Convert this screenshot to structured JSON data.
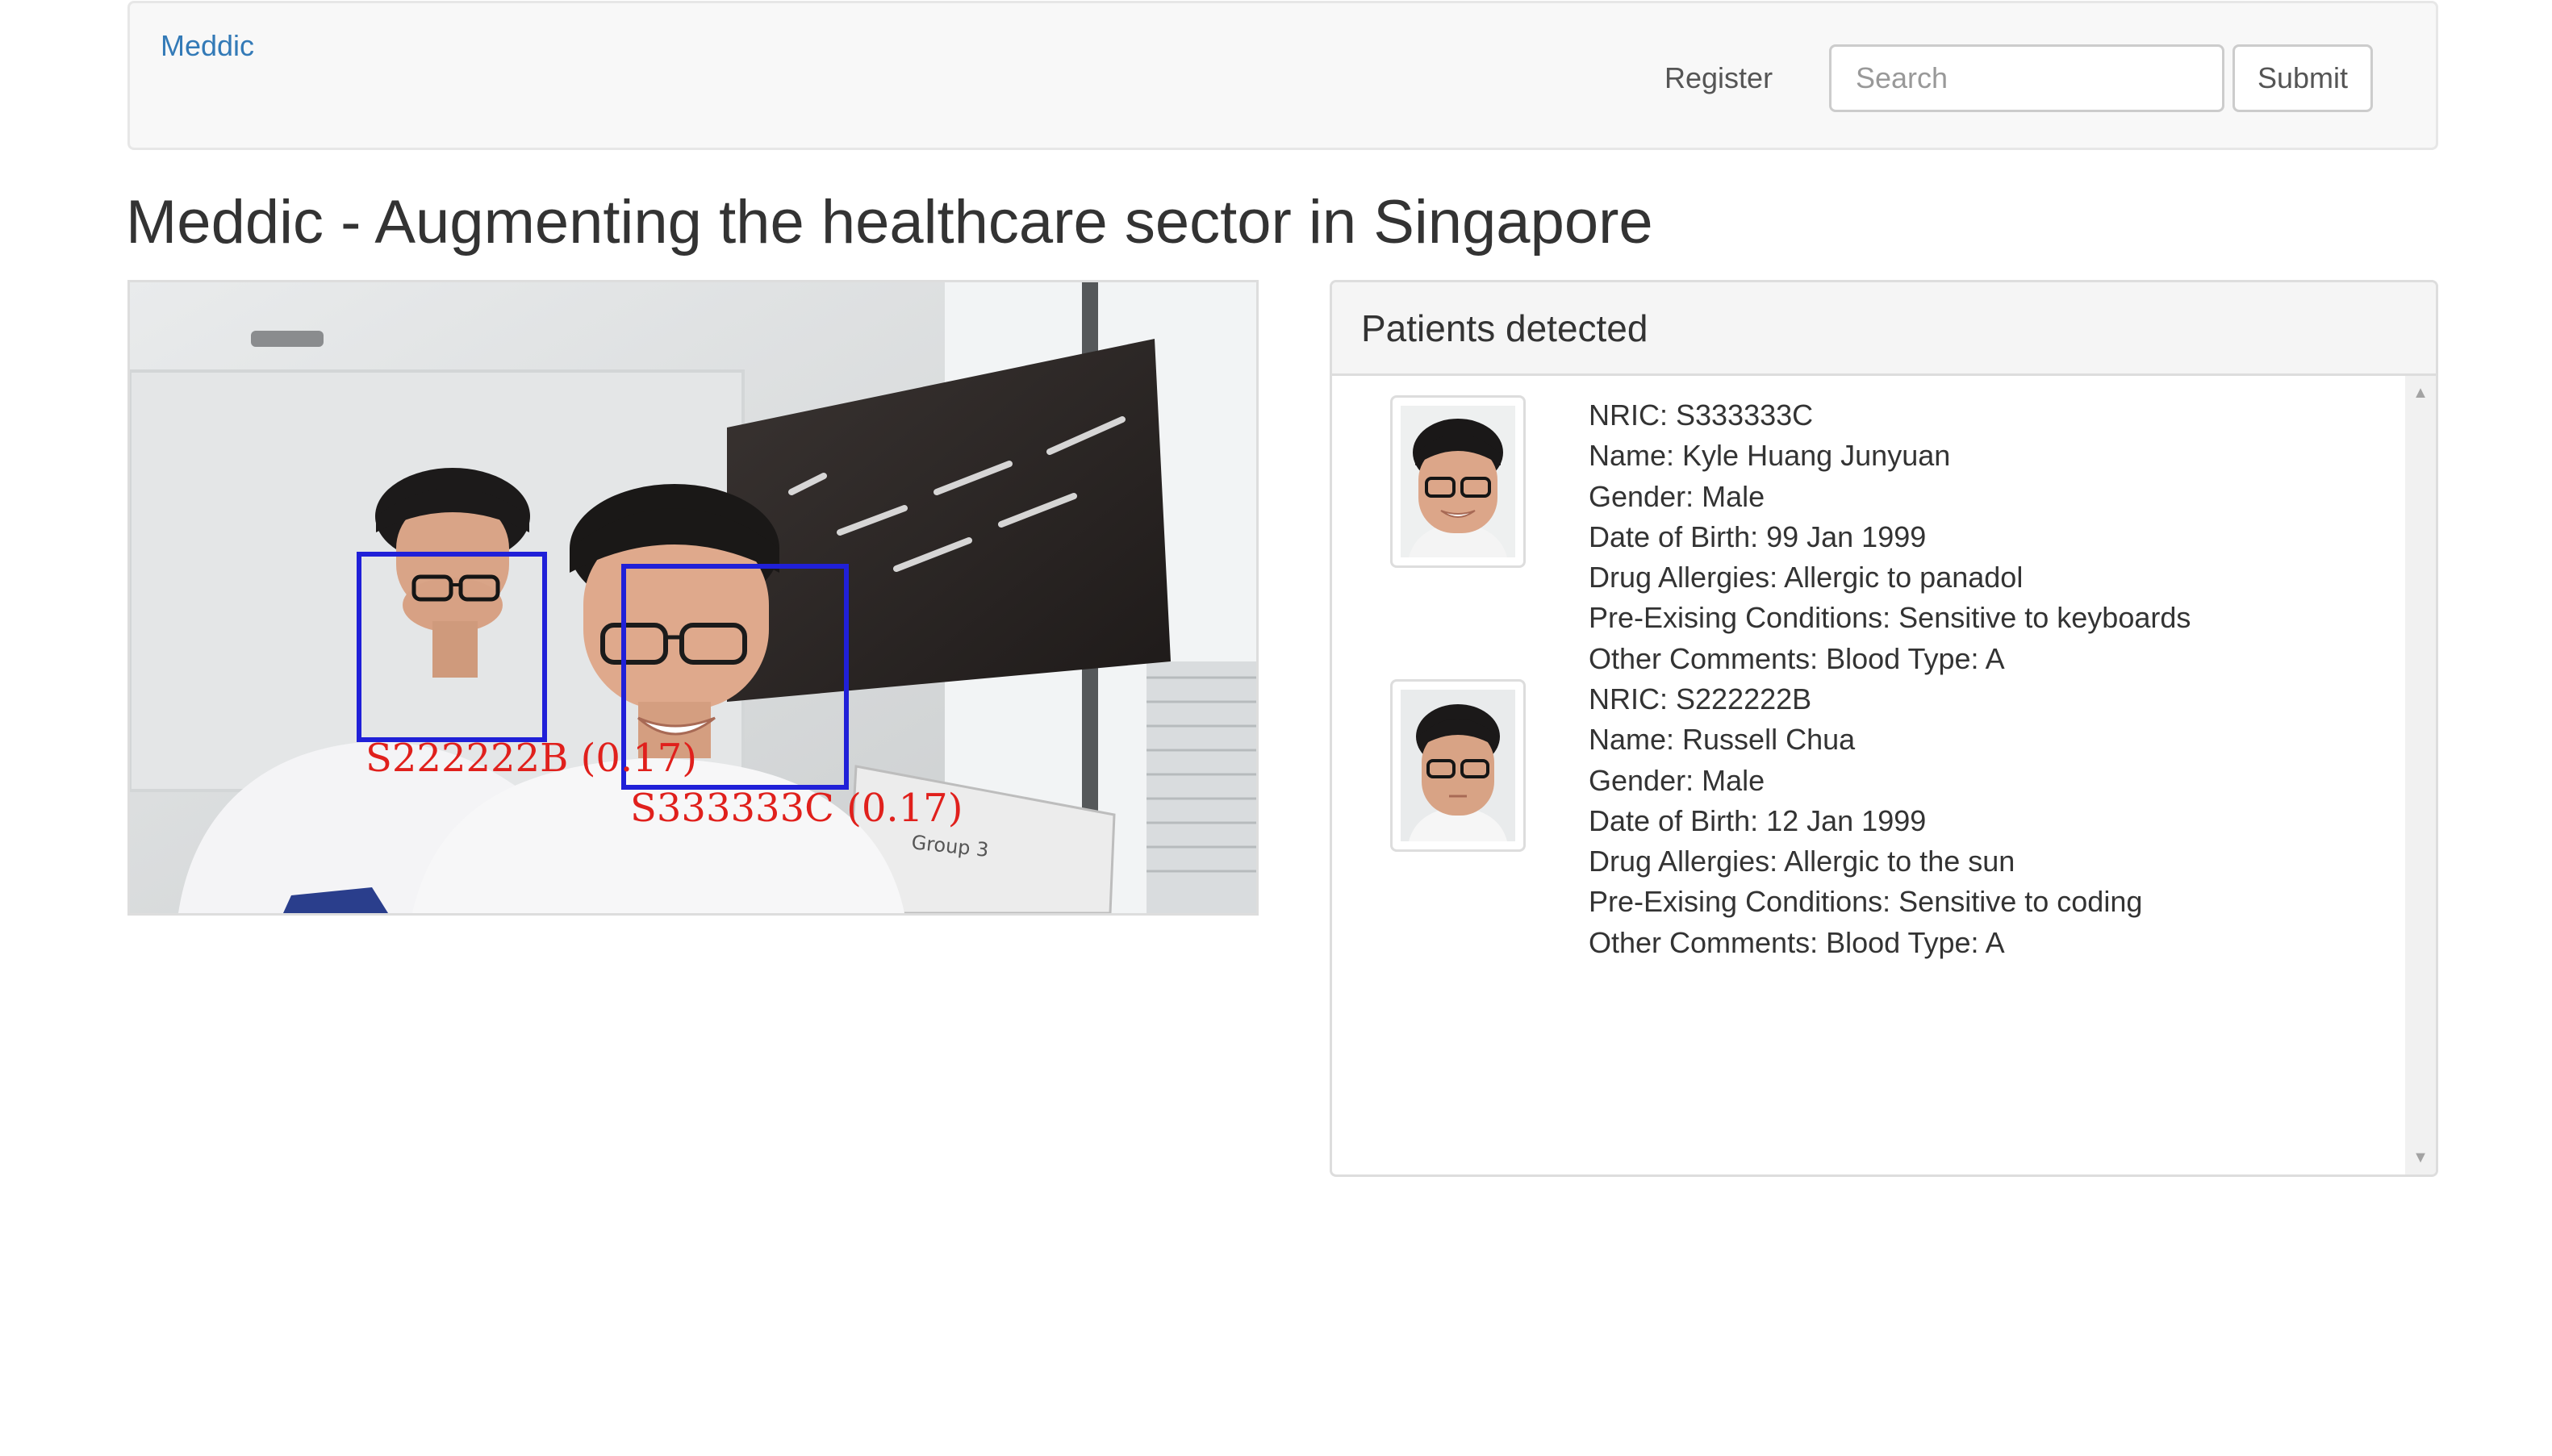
{
  "navbar": {
    "brand": "Meddic",
    "register_label": "Register",
    "search_placeholder": "Search",
    "submit_label": "Submit"
  },
  "page": {
    "title": "Meddic - Augmenting the healthcare sector in Singapore"
  },
  "camera_feed": {
    "detections": [
      {
        "label": "S222222B (0.17)"
      },
      {
        "label": "S333333C (0.17)"
      }
    ],
    "sign_text": "Group 3",
    "box_color": "#2020d8",
    "label_color": "#e0201c"
  },
  "patients_panel": {
    "heading": "Patients detected",
    "patients": [
      {
        "nric": "NRIC: S333333C",
        "name": "Name: Kyle Huang Junyuan",
        "gender": "Gender: Male",
        "dob": "Date of Birth: 99 Jan 1999",
        "allergies": "Drug Allergies: Allergic to panadol",
        "conditions": "Pre-Exising Conditions: Sensitive to keyboards",
        "comments": "Other Comments: Blood Type: A"
      },
      {
        "nric": "NRIC: S222222B",
        "name": "Name: Russell Chua",
        "gender": "Gender: Male",
        "dob": "Date of Birth: 12 Jan 1999",
        "allergies": "Drug Allergies: Allergic to the sun",
        "conditions": "Pre-Exising Conditions: Sensitive to coding",
        "comments": "Other Comments: Blood Type: A"
      }
    ]
  },
  "colors": {
    "brand_link": "#337ab7",
    "navbar_bg": "#f8f8f8",
    "panel_heading_bg": "#f5f5f5"
  },
  "icons": [
    "scroll-up-arrow-icon",
    "scroll-down-arrow-icon"
  ]
}
